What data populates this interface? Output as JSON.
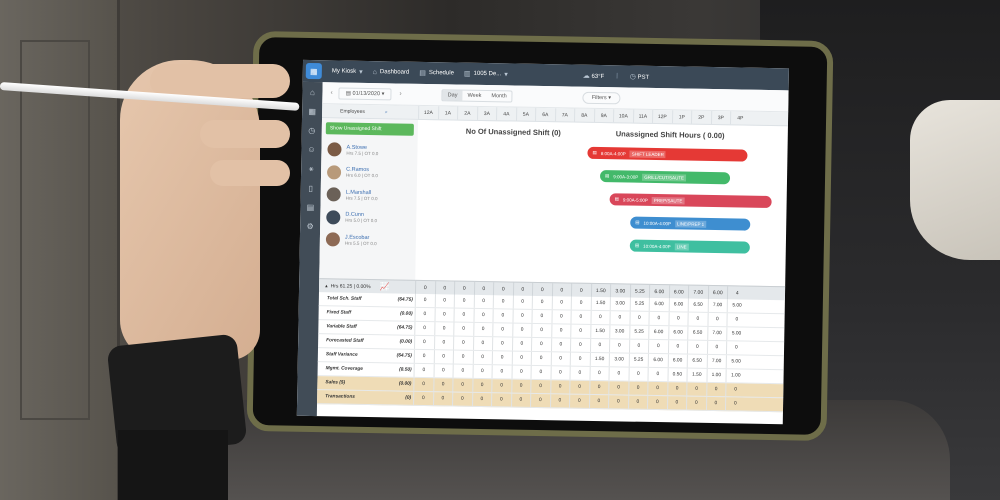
{
  "topbar": {
    "account": "My Kiosk",
    "dashboard": "Dashboard",
    "schedule": "Schedule",
    "store": "1005 De...",
    "weather": "63°F",
    "timezone": "PST"
  },
  "toolbar": {
    "date": "01/13/2020",
    "view_day": "Day",
    "view_week": "Week",
    "view_month": "Month",
    "filters": "Filters"
  },
  "hours_header": {
    "employees_label": "Employees",
    "hours": [
      "12A",
      "1A",
      "2A",
      "3A",
      "4A",
      "5A",
      "6A",
      "7A",
      "8A",
      "9A",
      "10A",
      "11A",
      "12P",
      "1P",
      "2P",
      "3P",
      "4P"
    ]
  },
  "employees": {
    "show_unassigned": "Show Unassigned Shift",
    "list": [
      {
        "name": "A.Stowe",
        "sub": "Hrs 7.5 | OT 0.0"
      },
      {
        "name": "C.Ramos",
        "sub": "Hrs 6.0 | OT 0.0"
      },
      {
        "name": "L.Marshall",
        "sub": "Hrs 7.5 | OT 0.0"
      },
      {
        "name": "D.Cunn",
        "sub": "Hrs 5.0 | OT 0.0"
      },
      {
        "name": "J.Escobar",
        "sub": "Hrs 5.5 | OT 0.0"
      }
    ]
  },
  "gantt": {
    "unassigned_count_title": "No Of Unassigned Shift (0)",
    "unassigned_hours_title": "Unassigned Shift Hours ( 0.00)",
    "shifts": [
      {
        "time": "8:00A-4:00P",
        "role": "SHIFT LEADER",
        "color": "#e53935"
      },
      {
        "time": "9:00A-3:00P",
        "role": "GRILL/CUT/SAUTE",
        "color": "#43b96a"
      },
      {
        "time": "9:00A-5:00P",
        "role": "PREP/SAUTE",
        "color": "#d9475a"
      },
      {
        "time": "10:00A-4:00P",
        "role": "LINE/PREP 1",
        "color": "#3e8ed0"
      },
      {
        "time": "10:00A-4:00P",
        "role": "LINE",
        "color": "#3fbfa0"
      }
    ]
  },
  "summary": {
    "label": "Hrs 61.25 | 0.00%",
    "values": [
      "0",
      "0",
      "0",
      "0",
      "0",
      "0",
      "0",
      "0",
      "0",
      "1.50",
      "3.00",
      "5.25",
      "6.00",
      "6.00",
      "7.00",
      "6.00",
      "4"
    ]
  },
  "table": [
    {
      "label": "Total Sch. Staff",
      "total": "(64.75)",
      "tan": false,
      "values": [
        "0",
        "0",
        "0",
        "0",
        "0",
        "0",
        "0",
        "0",
        "0",
        "1.50",
        "3.00",
        "5.25",
        "6.00",
        "6.00",
        "6.50",
        "7.00",
        "5.00"
      ]
    },
    {
      "label": "Fixed Staff",
      "total": "(0.00)",
      "tan": false,
      "values": [
        "0",
        "0",
        "0",
        "0",
        "0",
        "0",
        "0",
        "0",
        "0",
        "0",
        "0",
        "0",
        "0",
        "0",
        "0",
        "0",
        "0"
      ]
    },
    {
      "label": "Variable Staff",
      "total": "(64.75)",
      "tan": false,
      "values": [
        "0",
        "0",
        "0",
        "0",
        "0",
        "0",
        "0",
        "0",
        "0",
        "1.50",
        "3.00",
        "5.25",
        "6.00",
        "6.00",
        "6.50",
        "7.00",
        "5.00"
      ]
    },
    {
      "label": "Forecasted Staff",
      "total": "(0.00)",
      "tan": false,
      "values": [
        "0",
        "0",
        "0",
        "0",
        "0",
        "0",
        "0",
        "0",
        "0",
        "0",
        "0",
        "0",
        "0",
        "0",
        "0",
        "0",
        "0"
      ]
    },
    {
      "label": "Staff Variance",
      "total": "(64.75)",
      "tan": false,
      "values": [
        "0",
        "0",
        "0",
        "0",
        "0",
        "0",
        "0",
        "0",
        "0",
        "1.50",
        "3.00",
        "5.25",
        "6.00",
        "6.00",
        "6.50",
        "7.00",
        "5.00"
      ]
    },
    {
      "label": "Mgmt. Coverage",
      "total": "(8.50)",
      "tan": false,
      "values": [
        "0",
        "0",
        "0",
        "0",
        "0",
        "0",
        "0",
        "0",
        "0",
        "0",
        "0",
        "0",
        "0",
        "0.50",
        "1.50",
        "1.00",
        "1.00"
      ]
    },
    {
      "label": "Sales ($)",
      "total": "(0.00)",
      "tan": true,
      "values": [
        "0",
        "0",
        "0",
        "0",
        "0",
        "0",
        "0",
        "0",
        "0",
        "0",
        "0",
        "0",
        "0",
        "0",
        "0",
        "0",
        "0"
      ]
    },
    {
      "label": "Transactions",
      "total": "(0)",
      "tan": true,
      "values": [
        "0",
        "0",
        "0",
        "0",
        "0",
        "0",
        "0",
        "0",
        "0",
        "0",
        "0",
        "0",
        "0",
        "0",
        "0",
        "0",
        "0"
      ]
    }
  ]
}
